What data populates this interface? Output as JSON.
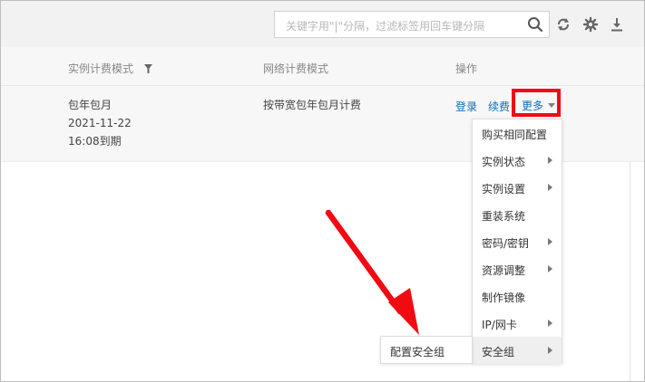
{
  "toolbar": {
    "search_placeholder": "关键字用\"|\"分隔，过滤标签用回车键分隔",
    "icons": [
      "search-icon",
      "refresh-icon",
      "gear-icon",
      "download-icon"
    ]
  },
  "table": {
    "columns": [
      "实例计费模式",
      "网络计费模式",
      "操作"
    ],
    "rows": [
      {
        "billing": [
          "包年包月",
          "2021-11-22",
          "16:08到期"
        ],
        "network_billing": "按带宽包年包月计费",
        "actions": [
          "登录",
          "续费",
          "更多"
        ]
      }
    ]
  },
  "more_menu": {
    "items": [
      {
        "label": "购买相同配置",
        "submenu": false
      },
      {
        "label": "实例状态",
        "submenu": true
      },
      {
        "label": "实例设置",
        "submenu": true
      },
      {
        "label": "重装系统",
        "submenu": false
      },
      {
        "label": "密码/密钥",
        "submenu": true
      },
      {
        "label": "资源调整",
        "submenu": true
      },
      {
        "label": "制作镜像",
        "submenu": false
      },
      {
        "label": "IP/网卡",
        "submenu": true
      },
      {
        "label": "安全组",
        "submenu": true,
        "active": true
      }
    ],
    "security_group_submenu": [
      "配置安全组"
    ]
  },
  "colors": {
    "link": "#0a6ebd",
    "highlight": "#f20a13"
  }
}
